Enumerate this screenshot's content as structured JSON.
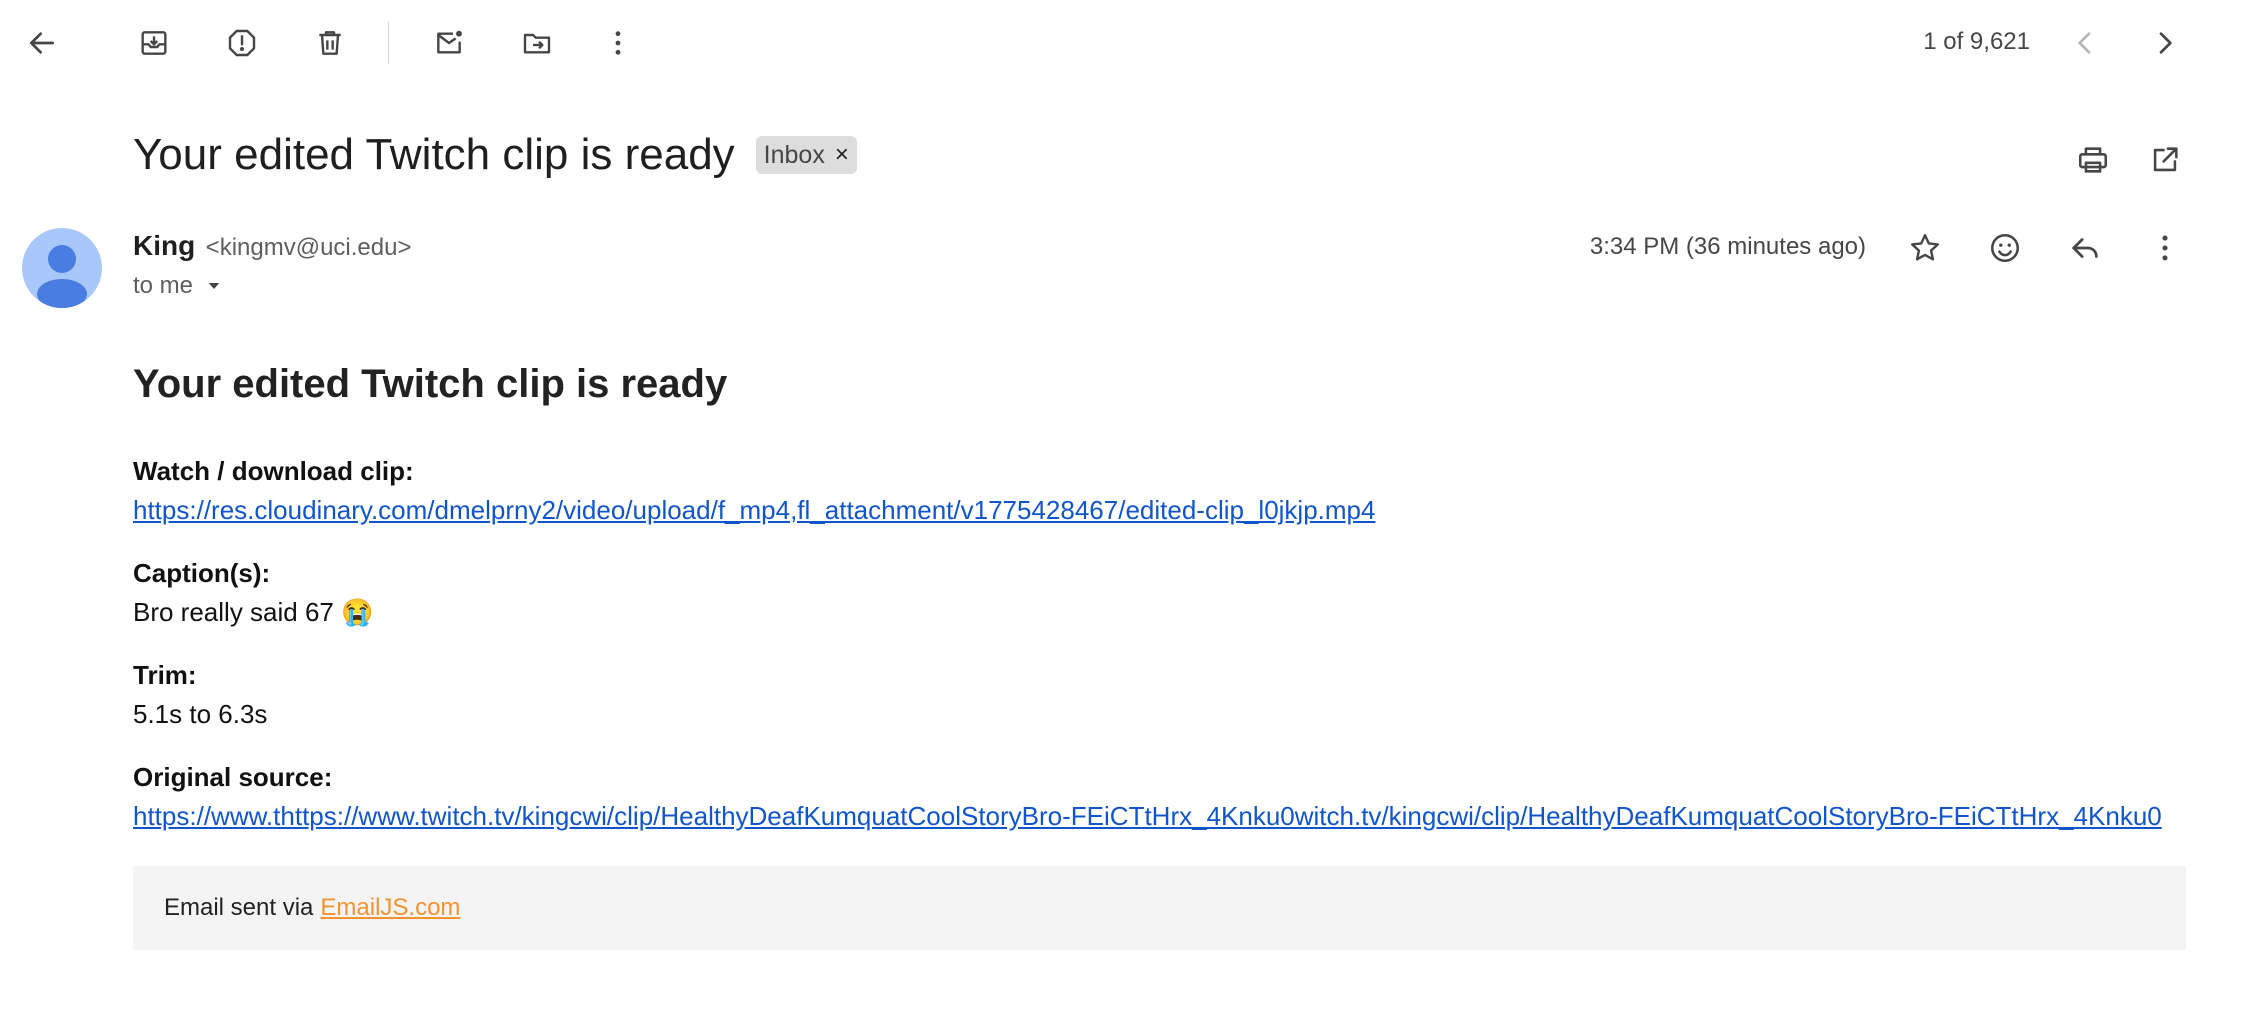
{
  "toolbar": {
    "back_icon": "arrow-left-icon",
    "archive_icon": "archive-icon",
    "spam_icon": "report-spam-icon",
    "delete_icon": "trash-icon",
    "unread_icon": "mark-unread-icon",
    "move_icon": "move-to-folder-icon",
    "more_icon": "more-vertical-icon",
    "pager": "1 of 9,621",
    "prev_icon": "chevron-left-icon",
    "next_icon": "chevron-right-icon"
  },
  "email": {
    "subject": "Your edited Twitch clip is ready",
    "label": "Inbox",
    "label_remove": "×",
    "sender_name": "King",
    "sender_email": "<kingmv@uci.edu>",
    "recipient": "to me",
    "timestamp": "3:34 PM (36 minutes ago)"
  },
  "body": {
    "heading": "Your edited Twitch clip is ready",
    "watch_label": "Watch / download clip:",
    "watch_url": "https://res.cloudinary.com/dmelprny2/video/upload/f_mp4,fl_attachment/v1775428467/edited-clip_l0jkjp.mp4",
    "caption_label": "Caption(s):",
    "caption_text": "Bro really said 67 😭",
    "trim_label": "Trim:",
    "trim_text": "5.1s to 6.3s",
    "source_label": "Original source:",
    "source_url": "https://www.thttps://www.twitch.tv/kingcwi/clip/HealthyDeafKumquatCoolStoryBro-FEiCTtHrx_4Knku0witch.tv/kingcwi/clip/HealthyDeafKumquatCoolStoryBro-FEiCTtHrx_4Knku0"
  },
  "footer": {
    "prefix": "Email sent via",
    "link_text": "EmailJS.com",
    "link_color": "#f5922f"
  },
  "colors": {
    "link": "#1155cc",
    "avatar_bg": "#a8c7fa",
    "avatar_fg": "#4a7de2",
    "chip_bg": "#dddddd"
  }
}
